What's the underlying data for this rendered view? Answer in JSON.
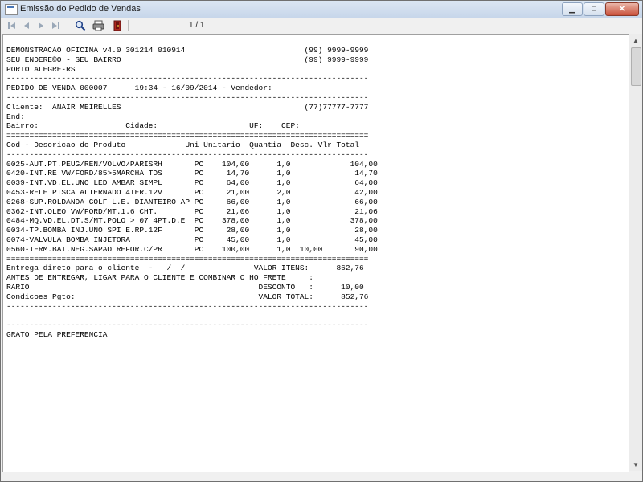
{
  "window": {
    "title": "Emissão do Pedido de Vendas",
    "minimize": "▁",
    "maximize": "□",
    "close": "✕"
  },
  "toolbar": {
    "first_icon": "first-page-icon",
    "prev_icon": "previous-page-icon",
    "next_icon": "next-page-icon",
    "last_icon": "last-page-icon",
    "zoom_icon": "magnifier-icon",
    "print_icon": "printer-icon",
    "exit_icon": "exit-door-icon",
    "page_indicator": "1 / 1"
  },
  "report": {
    "lines": [
      "DEMONSTRACAO OFICINA v4.0 301214 010914                          (99) 9999-9999",
      "SEU ENDERE©O - SEU BAIRRO                                        (99) 9999-9999",
      "PORTO ALEGRE-RS",
      "-------------------------------------------------------------------------------",
      "PEDIDO DE VENDA 000007      19:34 - 16/09/2014 - Vendedor:",
      "-------------------------------------------------------------------------------",
      "Cliente:  ANAIR MEIRELLES                                        (77)77777-7777",
      "End:",
      "Bairro:                   Cidade:                    UF:    CEP:",
      "===============================================================================",
      "Cod - Descricao do Produto             Uni Unitario  Quantia  Desc. Vlr Total",
      "-------------------------------------------------------------------------------",
      "0025-AUT.PT.PEUG/REN/VOLVO/PARISRH       PC    104,00      1,0             104,00",
      "0420-INT.RE VW/FORD/85>5MARCHA TDS       PC     14,70      1,0              14,70",
      "0039-INT.VD.EL.UNO LED AMBAR SIMPL       PC     64,00      1,0              64,00",
      "0453-RELE PISCA ALTERNADO 4TER.12V       PC     21,00      2,0              42,00",
      "0268-SUP.ROLDANDA GOLF L.E. DIANTEIRO AP PC     66,00      1,0              66,00",
      "0362-INT.OLEO VW/FORD/MT.1.6 CHT.        PC     21,06      1,0              21,06",
      "0484-MQ.VD.EL.DT.S/MT.POLO > 07 4PT.D.E  PC    378,00      1,0             378,00",
      "0034-TP.BOMBA INJ.UNO SPI E.RP.12F       PC     28,00      1,0              28,00",
      "0074-VALVULA BOMBA INJETORA              PC     45,00      1,0              45,00",
      "0560-TERM.BAT.NEG.SAPAO REFOR.C/PR       PC    100,00      1,0  10,00       90,00",
      "===============================================================================",
      "Entrega direto para o cliente  -   /  /               VALOR ITENS:      862,76",
      "ANTES DE ENTREGAR, LIGAR PARA O CLIENTE E COMBINAR O HO FRETE     :",
      "RARIO                                                  DESCONTO   :      10,00",
      "Condicoes Pgto:                                        VALOR TOTAL:      852,76",
      "-------------------------------------------------------------------------------",
      "",
      "-------------------------------------------------------------------------------",
      "GRATO PELA PREFERENCIA"
    ]
  },
  "scrollbar": {
    "up_icon": "scroll-up-icon",
    "down_icon": "scroll-down-icon"
  }
}
